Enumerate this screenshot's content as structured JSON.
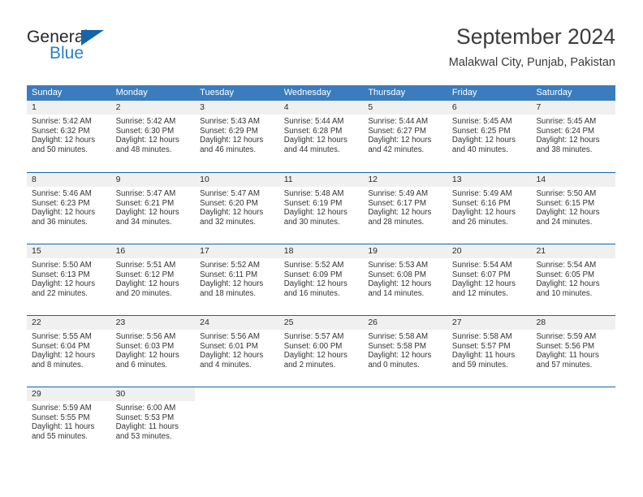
{
  "logo": {
    "word_top": "General",
    "word_bottom": "Blue",
    "triangle_color": "#1565a8",
    "blue_color": "#2a7fc9"
  },
  "header": {
    "title": "September 2024",
    "subtitle": "Malakwal City, Punjab, Pakistan"
  },
  "theme": {
    "header_band": "#3a7cbe",
    "row_divider": "#1565a8",
    "daynum_band": "#f0f0f0"
  },
  "weekdays": [
    "Sunday",
    "Monday",
    "Tuesday",
    "Wednesday",
    "Thursday",
    "Friday",
    "Saturday"
  ],
  "weeks": [
    [
      {
        "day": "1",
        "sunrise": "Sunrise: 5:42 AM",
        "sunset": "Sunset: 6:32 PM",
        "daylight_line1": "Daylight: 12 hours",
        "daylight_line2": "and 50 minutes."
      },
      {
        "day": "2",
        "sunrise": "Sunrise: 5:42 AM",
        "sunset": "Sunset: 6:30 PM",
        "daylight_line1": "Daylight: 12 hours",
        "daylight_line2": "and 48 minutes."
      },
      {
        "day": "3",
        "sunrise": "Sunrise: 5:43 AM",
        "sunset": "Sunset: 6:29 PM",
        "daylight_line1": "Daylight: 12 hours",
        "daylight_line2": "and 46 minutes."
      },
      {
        "day": "4",
        "sunrise": "Sunrise: 5:44 AM",
        "sunset": "Sunset: 6:28 PM",
        "daylight_line1": "Daylight: 12 hours",
        "daylight_line2": "and 44 minutes."
      },
      {
        "day": "5",
        "sunrise": "Sunrise: 5:44 AM",
        "sunset": "Sunset: 6:27 PM",
        "daylight_line1": "Daylight: 12 hours",
        "daylight_line2": "and 42 minutes."
      },
      {
        "day": "6",
        "sunrise": "Sunrise: 5:45 AM",
        "sunset": "Sunset: 6:25 PM",
        "daylight_line1": "Daylight: 12 hours",
        "daylight_line2": "and 40 minutes."
      },
      {
        "day": "7",
        "sunrise": "Sunrise: 5:45 AM",
        "sunset": "Sunset: 6:24 PM",
        "daylight_line1": "Daylight: 12 hours",
        "daylight_line2": "and 38 minutes."
      }
    ],
    [
      {
        "day": "8",
        "sunrise": "Sunrise: 5:46 AM",
        "sunset": "Sunset: 6:23 PM",
        "daylight_line1": "Daylight: 12 hours",
        "daylight_line2": "and 36 minutes."
      },
      {
        "day": "9",
        "sunrise": "Sunrise: 5:47 AM",
        "sunset": "Sunset: 6:21 PM",
        "daylight_line1": "Daylight: 12 hours",
        "daylight_line2": "and 34 minutes."
      },
      {
        "day": "10",
        "sunrise": "Sunrise: 5:47 AM",
        "sunset": "Sunset: 6:20 PM",
        "daylight_line1": "Daylight: 12 hours",
        "daylight_line2": "and 32 minutes."
      },
      {
        "day": "11",
        "sunrise": "Sunrise: 5:48 AM",
        "sunset": "Sunset: 6:19 PM",
        "daylight_line1": "Daylight: 12 hours",
        "daylight_line2": "and 30 minutes."
      },
      {
        "day": "12",
        "sunrise": "Sunrise: 5:49 AM",
        "sunset": "Sunset: 6:17 PM",
        "daylight_line1": "Daylight: 12 hours",
        "daylight_line2": "and 28 minutes."
      },
      {
        "day": "13",
        "sunrise": "Sunrise: 5:49 AM",
        "sunset": "Sunset: 6:16 PM",
        "daylight_line1": "Daylight: 12 hours",
        "daylight_line2": "and 26 minutes."
      },
      {
        "day": "14",
        "sunrise": "Sunrise: 5:50 AM",
        "sunset": "Sunset: 6:15 PM",
        "daylight_line1": "Daylight: 12 hours",
        "daylight_line2": "and 24 minutes."
      }
    ],
    [
      {
        "day": "15",
        "sunrise": "Sunrise: 5:50 AM",
        "sunset": "Sunset: 6:13 PM",
        "daylight_line1": "Daylight: 12 hours",
        "daylight_line2": "and 22 minutes."
      },
      {
        "day": "16",
        "sunrise": "Sunrise: 5:51 AM",
        "sunset": "Sunset: 6:12 PM",
        "daylight_line1": "Daylight: 12 hours",
        "daylight_line2": "and 20 minutes."
      },
      {
        "day": "17",
        "sunrise": "Sunrise: 5:52 AM",
        "sunset": "Sunset: 6:11 PM",
        "daylight_line1": "Daylight: 12 hours",
        "daylight_line2": "and 18 minutes."
      },
      {
        "day": "18",
        "sunrise": "Sunrise: 5:52 AM",
        "sunset": "Sunset: 6:09 PM",
        "daylight_line1": "Daylight: 12 hours",
        "daylight_line2": "and 16 minutes."
      },
      {
        "day": "19",
        "sunrise": "Sunrise: 5:53 AM",
        "sunset": "Sunset: 6:08 PM",
        "daylight_line1": "Daylight: 12 hours",
        "daylight_line2": "and 14 minutes."
      },
      {
        "day": "20",
        "sunrise": "Sunrise: 5:54 AM",
        "sunset": "Sunset: 6:07 PM",
        "daylight_line1": "Daylight: 12 hours",
        "daylight_line2": "and 12 minutes."
      },
      {
        "day": "21",
        "sunrise": "Sunrise: 5:54 AM",
        "sunset": "Sunset: 6:05 PM",
        "daylight_line1": "Daylight: 12 hours",
        "daylight_line2": "and 10 minutes."
      }
    ],
    [
      {
        "day": "22",
        "sunrise": "Sunrise: 5:55 AM",
        "sunset": "Sunset: 6:04 PM",
        "daylight_line1": "Daylight: 12 hours",
        "daylight_line2": "and 8 minutes."
      },
      {
        "day": "23",
        "sunrise": "Sunrise: 5:56 AM",
        "sunset": "Sunset: 6:03 PM",
        "daylight_line1": "Daylight: 12 hours",
        "daylight_line2": "and 6 minutes."
      },
      {
        "day": "24",
        "sunrise": "Sunrise: 5:56 AM",
        "sunset": "Sunset: 6:01 PM",
        "daylight_line1": "Daylight: 12 hours",
        "daylight_line2": "and 4 minutes."
      },
      {
        "day": "25",
        "sunrise": "Sunrise: 5:57 AM",
        "sunset": "Sunset: 6:00 PM",
        "daylight_line1": "Daylight: 12 hours",
        "daylight_line2": "and 2 minutes."
      },
      {
        "day": "26",
        "sunrise": "Sunrise: 5:58 AM",
        "sunset": "Sunset: 5:58 PM",
        "daylight_line1": "Daylight: 12 hours",
        "daylight_line2": "and 0 minutes."
      },
      {
        "day": "27",
        "sunrise": "Sunrise: 5:58 AM",
        "sunset": "Sunset: 5:57 PM",
        "daylight_line1": "Daylight: 11 hours",
        "daylight_line2": "and 59 minutes."
      },
      {
        "day": "28",
        "sunrise": "Sunrise: 5:59 AM",
        "sunset": "Sunset: 5:56 PM",
        "daylight_line1": "Daylight: 11 hours",
        "daylight_line2": "and 57 minutes."
      }
    ],
    [
      {
        "day": "29",
        "sunrise": "Sunrise: 5:59 AM",
        "sunset": "Sunset: 5:55 PM",
        "daylight_line1": "Daylight: 11 hours",
        "daylight_line2": "and 55 minutes."
      },
      {
        "day": "30",
        "sunrise": "Sunrise: 6:00 AM",
        "sunset": "Sunset: 5:53 PM",
        "daylight_line1": "Daylight: 11 hours",
        "daylight_line2": "and 53 minutes."
      },
      {
        "day": "",
        "sunrise": "",
        "sunset": "",
        "daylight_line1": "",
        "daylight_line2": ""
      },
      {
        "day": "",
        "sunrise": "",
        "sunset": "",
        "daylight_line1": "",
        "daylight_line2": ""
      },
      {
        "day": "",
        "sunrise": "",
        "sunset": "",
        "daylight_line1": "",
        "daylight_line2": ""
      },
      {
        "day": "",
        "sunrise": "",
        "sunset": "",
        "daylight_line1": "",
        "daylight_line2": ""
      },
      {
        "day": "",
        "sunrise": "",
        "sunset": "",
        "daylight_line1": "",
        "daylight_line2": ""
      }
    ]
  ]
}
